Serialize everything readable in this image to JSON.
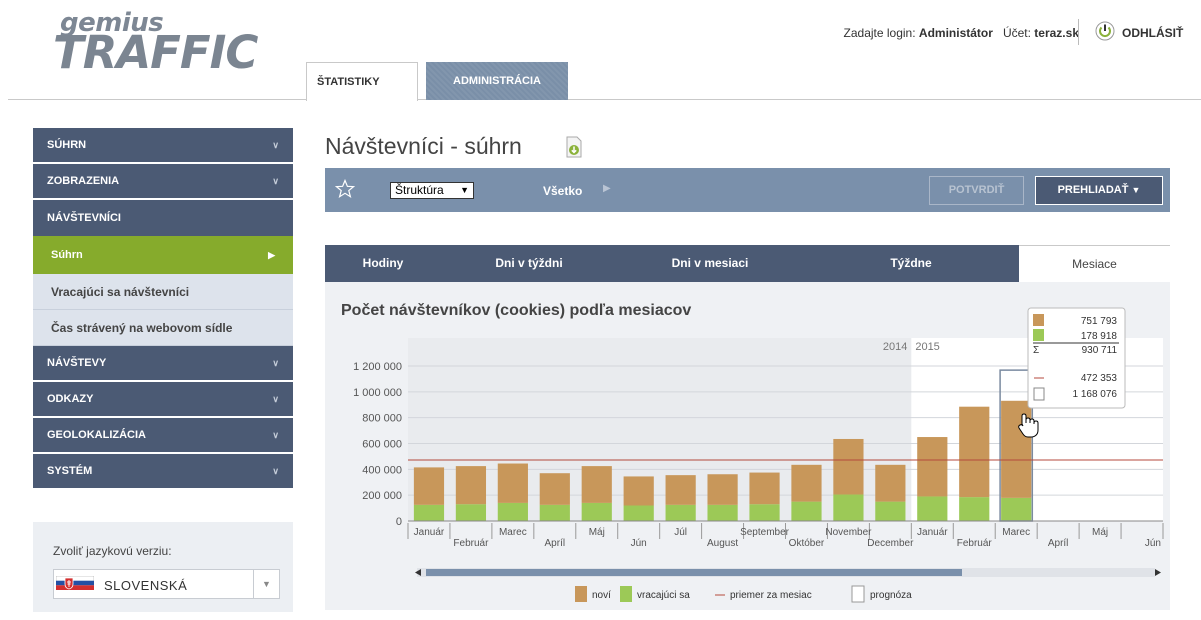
{
  "header": {
    "logo_top": "gemius",
    "logo_main": "TRAFFIC",
    "login_prefix": "Zadajte login:",
    "login_user": "Administátor",
    "account_prefix": "Účet:",
    "account_name": "teraz.sk",
    "logout_label": "ODHLÁSIŤ",
    "tabs": [
      {
        "label": "ŠTATISTIKY",
        "active": true
      },
      {
        "label": "ADMINISTRÁCIA",
        "active": false
      }
    ]
  },
  "sidebar": {
    "items": [
      {
        "label": "SÚHRN"
      },
      {
        "label": "ZOBRAZENIA"
      },
      {
        "label": "NÁVŠTEVNÍCI"
      }
    ],
    "sub_items": [
      {
        "label": "Súhrn"
      },
      {
        "label": "Vracajúci sa návštevníci"
      },
      {
        "label": "Čas strávený na webovom sídle"
      }
    ],
    "items_after": [
      {
        "label": "NÁVŠTEVY"
      },
      {
        "label": "ODKAZY"
      },
      {
        "label": "GEOLOKALIZÁCIA"
      },
      {
        "label": "SYSTÉM"
      }
    ],
    "language_label": "Zvoliť jazykovú verziu:",
    "language_value": "SLOVENSKÁ"
  },
  "main": {
    "title": "Návštevníci - súhrn",
    "structure_select": "Štruktúra",
    "filter_label": "Všetko",
    "confirm_button": "POTVRDIŤ",
    "browse_button": "PREHLIADAŤ",
    "time_tabs": [
      {
        "label": "Hodiny",
        "active": false
      },
      {
        "label": "Dni v týždni",
        "active": false
      },
      {
        "label": "Dni v mesiaci",
        "active": false
      },
      {
        "label": "Týždne",
        "active": false
      },
      {
        "label": "Mesiace",
        "active": true
      }
    ]
  },
  "tooltip": {
    "new_value": "751 793",
    "returning_value": "178 918",
    "sum_symbol": "Σ",
    "sum_value": "930 711",
    "avg_value": "472 353",
    "forecast_value": "1 168 076"
  },
  "colors": {
    "new": "#c8975a",
    "returning": "#9cc957",
    "average_line": "#b44a3c",
    "nav_dark": "#4b5a74",
    "nav_active": "#86ab2c",
    "toolbar": "#7a90ab"
  },
  "chart_data": {
    "type": "bar",
    "title": "Počet návštevníkov (cookies) podľa mesiacov",
    "year_labels": [
      "2014",
      "2015"
    ],
    "categories": [
      "Január",
      "Február",
      "Marec",
      "Apríl",
      "Máj",
      "Jún",
      "Júl",
      "August",
      "September",
      "Október",
      "November",
      "December",
      "Január",
      "Február",
      "Marec",
      "Apríl",
      "Máj",
      "Jún"
    ],
    "series": [
      {
        "name": "noví",
        "values": [
          290000,
          295000,
          305000,
          245000,
          285000,
          225000,
          230000,
          237000,
          245000,
          285000,
          430000,
          285000,
          460000,
          700000,
          751793,
          null,
          null,
          null
        ]
      },
      {
        "name": "vracajúci sa",
        "values": [
          125000,
          130000,
          140000,
          125000,
          140000,
          120000,
          125000,
          125000,
          130000,
          150000,
          205000,
          150000,
          190000,
          185000,
          178918,
          null,
          null,
          null
        ]
      }
    ],
    "average": 472353,
    "forecast_index": 14,
    "forecast_total": 1168076,
    "ylim": [
      0,
      1200000
    ],
    "yticks": [
      0,
      200000,
      400000,
      600000,
      800000,
      1000000,
      1200000
    ],
    "ytick_labels": [
      "0",
      "200 000",
      "400 000",
      "600 000",
      "800 000",
      "1 000 000",
      "1 200 000"
    ],
    "legend": [
      {
        "label": "noví"
      },
      {
        "label": "vracajúci sa"
      },
      {
        "label": "priemer za mesiac"
      },
      {
        "label": "prognóza"
      }
    ],
    "legend_position": "bottom"
  }
}
